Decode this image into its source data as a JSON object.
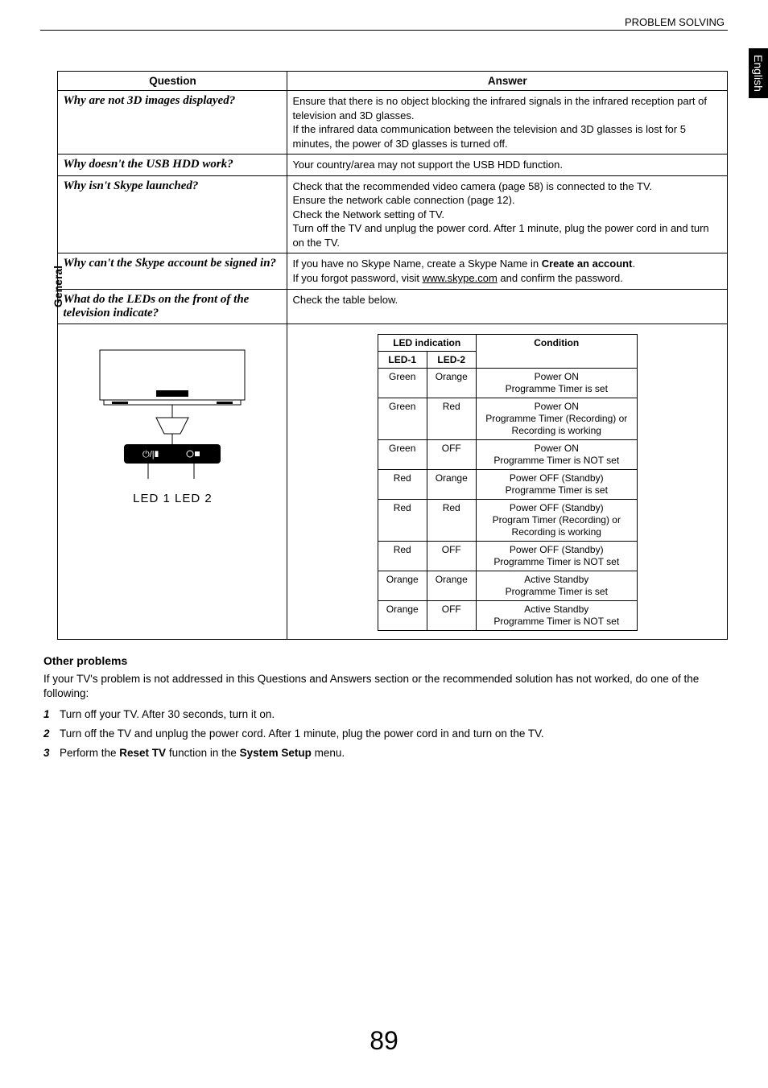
{
  "header": "PROBLEM SOLVING",
  "lang_tab": "English",
  "side_label": "General",
  "table": {
    "head_question": "Question",
    "head_answer": "Answer",
    "rows": [
      {
        "q": "Why are not 3D images displayed?",
        "a_lines": [
          "Ensure that there is no object blocking the infrared signals in the infrared reception part of television and 3D glasses.",
          "If the infrared data communication between the television and 3D glasses is lost for 5 minutes, the power of 3D glasses is turned off."
        ]
      },
      {
        "q": "Why doesn't the USB HDD work?",
        "a_lines": [
          "Your country/area may not support the USB HDD function."
        ]
      },
      {
        "q": "Why isn't Skype launched?",
        "a_lines": [
          "Check that the recommended video camera (page 58) is connected to the TV.",
          "Ensure the network cable connection (page 12).",
          "Check the Network setting of TV.",
          "Turn off the TV and unplug the power cord. After 1 minute, plug the power cord in and turn on the TV."
        ]
      }
    ],
    "skype_account": {
      "q": "Why can't the Skype account be signed in?",
      "a_pre": "If you have no Skype Name, create a Skype Name in ",
      "a_bold": "Create an account",
      "a_post1": ".",
      "a_line2_pre": "If you forgot password, visit ",
      "a_link": "www.skype.com",
      "a_line2_post": " and confirm the password."
    },
    "led_row": {
      "q": "What do the LEDs on the front of the television indicate?",
      "a": "Check the table below.",
      "diagram_label": "LED 1   LED 2"
    }
  },
  "led_table": {
    "head_group": "LED indication",
    "head_led1": "LED-1",
    "head_led2": "LED-2",
    "head_cond": "Condition",
    "rows": [
      {
        "l1": "Green",
        "l2": "Orange",
        "c1": "Power ON",
        "c2": "Programme Timer is set"
      },
      {
        "l1": "Green",
        "l2": "Red",
        "c1": "Power ON",
        "c2": "Programme Timer (Recording) or Recording is working"
      },
      {
        "l1": "Green",
        "l2": "OFF",
        "c1": "Power ON",
        "c2": "Programme Timer is NOT set"
      },
      {
        "l1": "Red",
        "l2": "Orange",
        "c1": "Power OFF (Standby)",
        "c2": "Programme Timer is set"
      },
      {
        "l1": "Red",
        "l2": "Red",
        "c1": "Power OFF (Standby)",
        "c2": "Program Timer (Recording) or Recording is working"
      },
      {
        "l1": "Red",
        "l2": "OFF",
        "c1": "Power OFF (Standby)",
        "c2": "Programme Timer is NOT set"
      },
      {
        "l1": "Orange",
        "l2": "Orange",
        "c1": "Active Standby",
        "c2": "Programme Timer is set"
      },
      {
        "l1": "Orange",
        "l2": "OFF",
        "c1": "Active Standby",
        "c2": "Programme Timer is NOT set"
      }
    ]
  },
  "other": {
    "title": "Other problems",
    "intro": "If your TV's problem is not addressed in this Questions and Answers section or the recommended solution has not worked, do one of the following:",
    "steps": {
      "s1": "Turn off your TV. After 30 seconds, turn it on.",
      "s2": "Turn off the TV and unplug the power cord. After 1 minute, plug the power cord in and turn on the TV.",
      "s3_pre": "Perform the ",
      "s3_b1": "Reset TV",
      "s3_mid": " function in the ",
      "s3_b2": "System Setup",
      "s3_post": " menu."
    }
  },
  "page_number": "89"
}
